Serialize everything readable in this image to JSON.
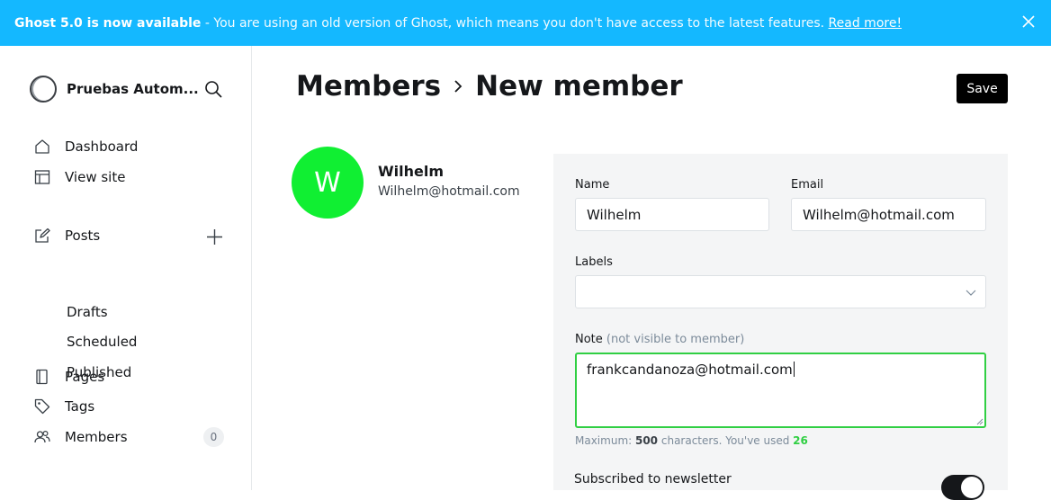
{
  "banner": {
    "title": "Ghost 5.0 is now available",
    "message": " - You are using an old version of Ghost, which means you don't have access to the latest features. ",
    "link": "Read more!",
    "color": "#14b8ff"
  },
  "sidebar": {
    "site_name": "Pruebas Autom...",
    "items": {
      "dashboard": "Dashboard",
      "view_site": "View site",
      "posts": "Posts",
      "drafts": "Drafts",
      "scheduled": "Scheduled",
      "published": "Published",
      "pages": "Pages",
      "tags": "Tags",
      "members": "Members"
    },
    "members_count": "0"
  },
  "header": {
    "crumb_parent": "Members",
    "crumb_current": "New member",
    "save_label": "Save"
  },
  "member": {
    "initial": "W",
    "name": "Wilhelm",
    "email": "Wilhelm@hotmail.com",
    "avatar_color": "#10ef32"
  },
  "form": {
    "name_label": "Name",
    "name_value": "Wilhelm",
    "email_label": "Email",
    "email_value": "Wilhelm@hotmail.com",
    "labels_label": "Labels",
    "labels_value": "",
    "note_label": "Note",
    "note_hint": "(not visible to member)",
    "note_value": "frankcandanoza@hotmail.com",
    "max_prefix": "Maximum: ",
    "max_value": "500",
    "max_mid": " characters. You've used ",
    "used_value": "26",
    "newsletter_label": "Subscribed to newsletter",
    "newsletter_on": true
  }
}
